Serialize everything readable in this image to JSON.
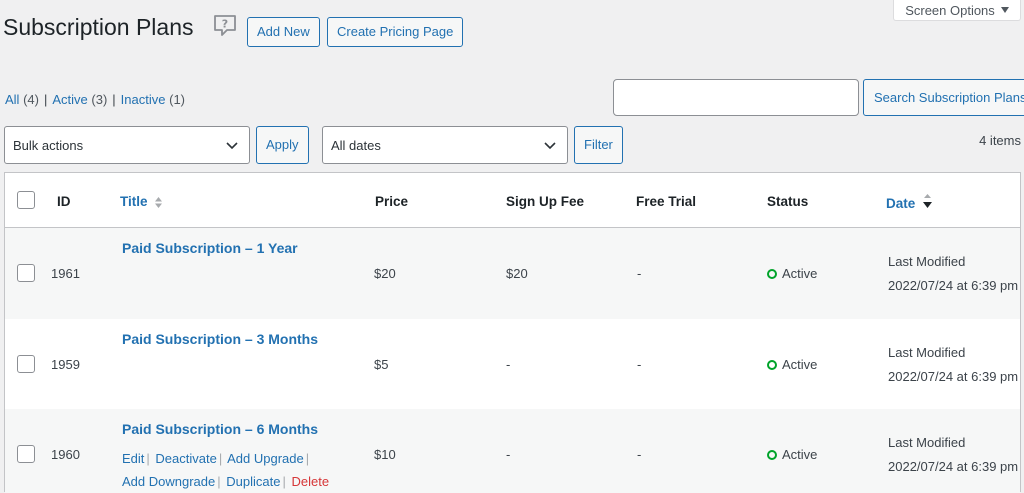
{
  "header": {
    "title": "Subscription Plans",
    "add_new": "Add New",
    "create_pricing": "Create Pricing Page",
    "screen_options": "Screen Options"
  },
  "views": {
    "all_label": "All",
    "all_count": "(4)",
    "active_label": "Active",
    "active_count": "(3)",
    "inactive_label": "Inactive",
    "inactive_count": "(1)"
  },
  "search": {
    "value": "",
    "button": "Search Subscription Plans"
  },
  "tablenav": {
    "bulk_selected": "Bulk actions",
    "apply": "Apply",
    "dates_selected": "All dates",
    "filter": "Filter",
    "items_count": "4 items"
  },
  "table": {
    "headers": {
      "id": "ID",
      "title": "Title",
      "price": "Price",
      "signup_fee": "Sign Up Fee",
      "free_trial": "Free Trial",
      "status": "Status",
      "date": "Date"
    },
    "rows": [
      {
        "id": "1961",
        "title": "Paid Subscription – 1 Year",
        "price": "$20",
        "signup_fee": "$20",
        "free_trial": "-",
        "status": "Active",
        "date_label": "Last Modified",
        "date_value": "2022/07/24 at 6:39 pm"
      },
      {
        "id": "1959",
        "title": "Paid Subscription – 3 Months",
        "price": "$5",
        "signup_fee": "-",
        "free_trial": "-",
        "status": "Active",
        "date_label": "Last Modified",
        "date_value": "2022/07/24 at 6:39 pm"
      },
      {
        "id": "1960",
        "title": "Paid Subscription – 6 Months",
        "price": "$10",
        "signup_fee": "-",
        "free_trial": "-",
        "status": "Active",
        "date_label": "Last Modified",
        "date_value": "2022/07/24 at 6:39 pm"
      }
    ],
    "row_actions": {
      "edit": "Edit",
      "deactivate": "Deactivate",
      "add_upgrade": "Add Upgrade",
      "add_downgrade": "Add Downgrade",
      "duplicate": "Duplicate",
      "delete": "Delete"
    }
  },
  "colors": {
    "link": "#2271b1",
    "active": "#00a32a",
    "danger": "#d63638"
  }
}
